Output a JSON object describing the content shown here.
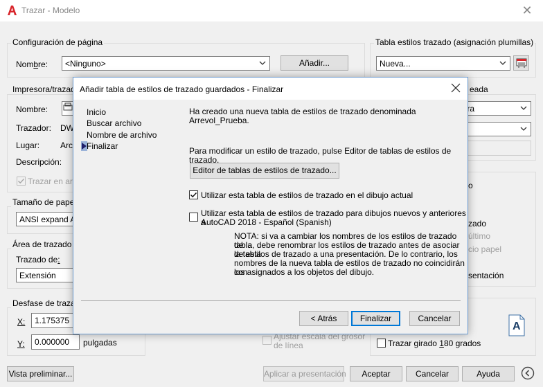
{
  "window": {
    "title": "Trazar - Modelo",
    "close_glyph": "✕"
  },
  "page_setup": {
    "group_label": "Configuración de página",
    "name_label": "Nombre:",
    "name_value": "<Ninguno>",
    "add_button": "Añadir..."
  },
  "plot_style_table": {
    "group_label": "Tabla estilos trazado (asignación plumillas)",
    "value": "Nueva...",
    "edit_icon": "edit-table-icon"
  },
  "printer": {
    "group_label": "Impresora/trazador",
    "name_label": "Nombre:",
    "plotter_label": "Trazador:",
    "plotter_value": "DW",
    "location_label": "Lugar:",
    "location_value": "Arch",
    "description_label": "Descripción:",
    "plot_to_file_label": "Trazar en arch"
  },
  "shaded_viewport": {
    "group_label": "eada",
    "shade_value": "stra"
  },
  "paper_size": {
    "group_label": "Tamaño de papel",
    "value": "ANSI expand A"
  },
  "plot_area": {
    "group_label": "Área de trazado",
    "plot_what_label": "Trazado de:",
    "plot_what_value": "Extensión"
  },
  "plot_offset": {
    "group_label": "Desfase de trazado",
    "x_label": "X:",
    "x_value": "1.175375",
    "y_label": "Y:",
    "y_value": "0.000000",
    "units": "pulgadas"
  },
  "right_options": {
    "option_1": "zado",
    "option_2": "último",
    "option_3": "cio papel",
    "option_4": "sentación",
    "row1_tail": "o"
  },
  "scale_lineweights": {
    "label_line1": "Ajustar escala del grosor",
    "label_line2": "de línea"
  },
  "orientation": {
    "upside_down_label": "Trazar girado 180 grados",
    "orientation_icon_letter": "A"
  },
  "footer": {
    "preview": "Vista preliminar...",
    "apply_to_layout": "Aplicar a presentación",
    "ok": "Aceptar",
    "cancel": "Cancelar",
    "help": "Ayuda",
    "more_icon": "chevron-left-circle-icon"
  },
  "wizard": {
    "title": "Añadir tabla de estilos de trazado guardados - Finalizar",
    "steps": [
      "Inicio",
      "Buscar archivo",
      "Nombre de archivo",
      "Finalizar"
    ],
    "current_step": "Finalizar",
    "created_msg": "Ha creado una nueva tabla de estilos de trazado denominada Arrevol_Prueba.",
    "modify_msg": "Para modificar un estilo de trazado, pulse Editor de tablas de estilos de trazado.",
    "editor_button": "Editor de tablas de estilos de trazado...",
    "use_current_label": "Utilizar esta tabla de estilos de trazado en el dibujo actual",
    "use_current_checked": true,
    "use_new_label_line1": "Utilizar esta tabla de estilos de trazado para dibujos nuevos y anteriores a",
    "use_new_label_line2": "AutoCAD 2018 - Español (Spanish)",
    "use_new_checked": false,
    "note_lines": [
      "NOTA: si va a cambiar los nombres de los estilos de trazado de la",
      "tabla, debe renombrar los estilos de trazado antes de asociar la tabla",
      "de estilos de trazado a una presentación. De lo contrario, los",
      "nombres de la nueva tabla de estilos de trazado no coincidirán con",
      "los asignados a los objetos del dibujo."
    ],
    "back_button": "< Atrás",
    "finish_button": "Finalizar",
    "cancel_button": "Cancelar"
  }
}
